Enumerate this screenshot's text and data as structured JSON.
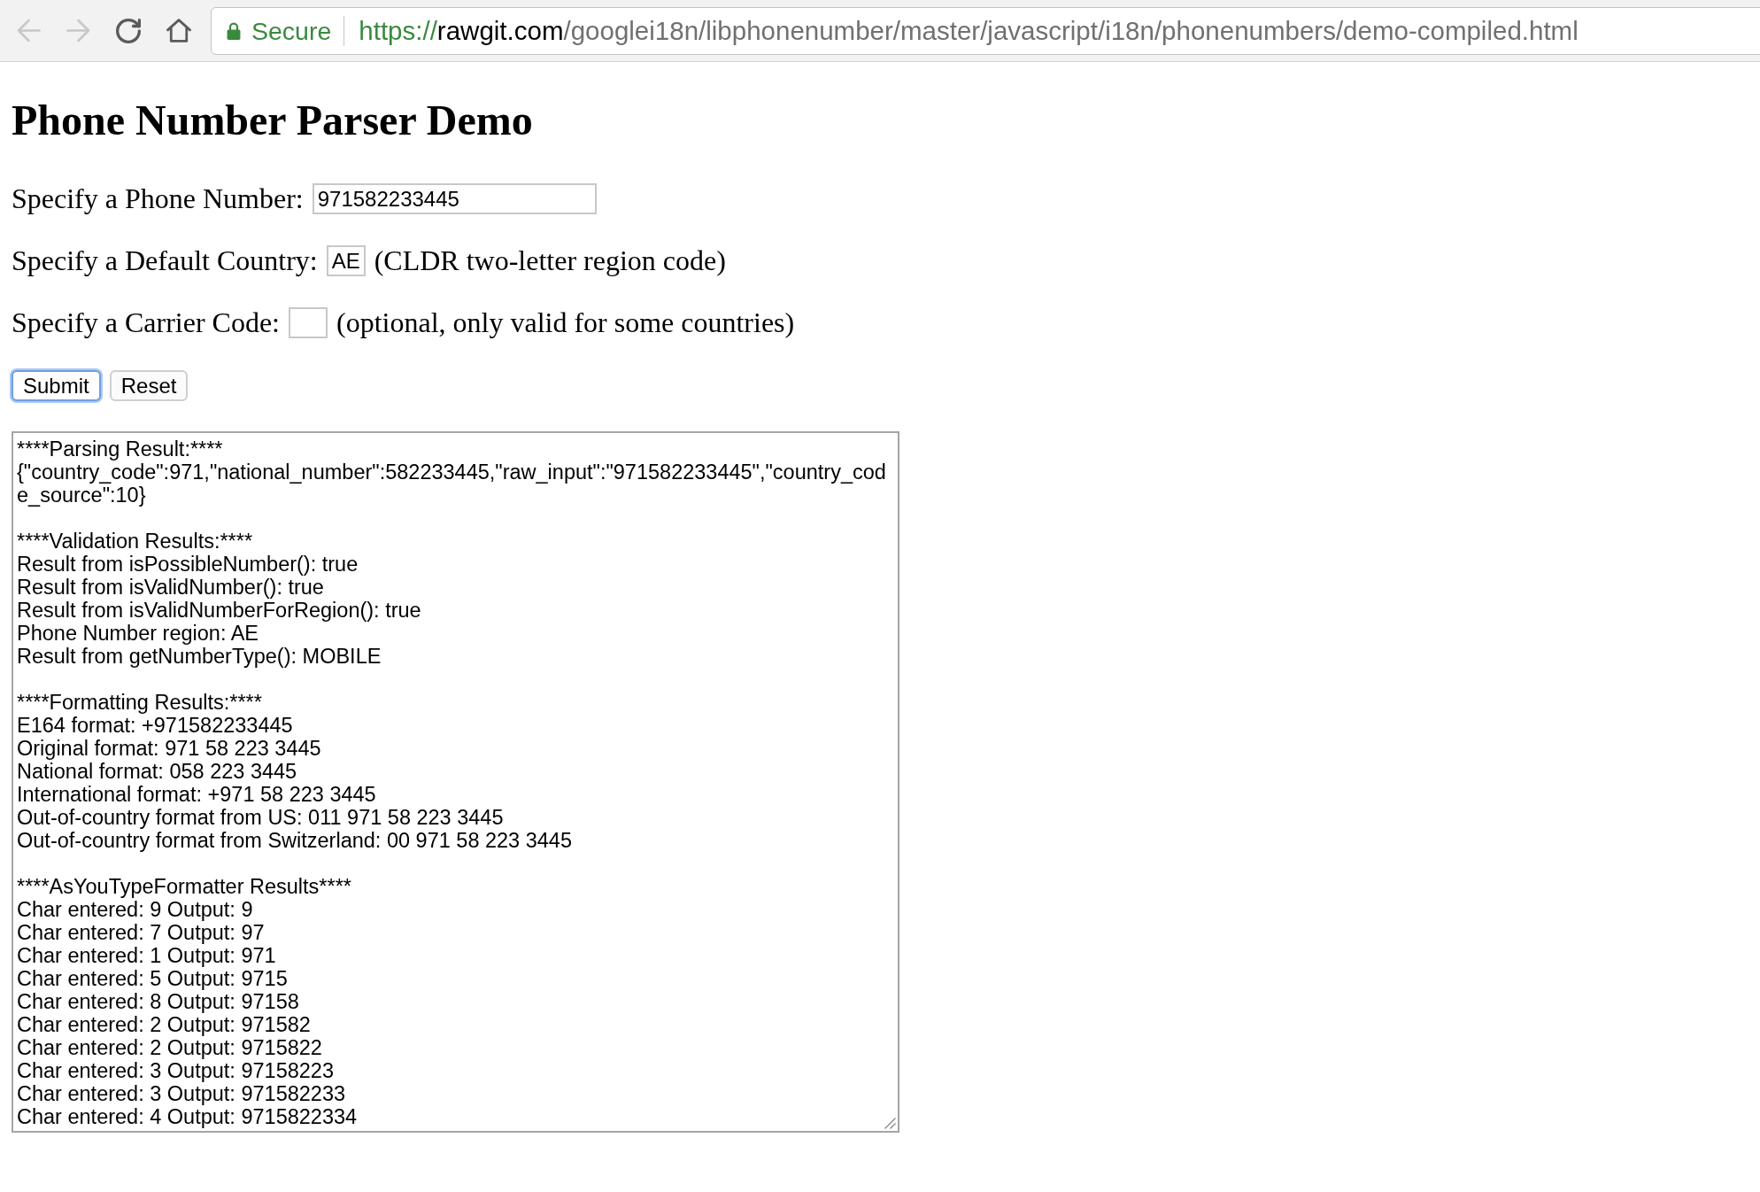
{
  "browser": {
    "nav_buttons": [
      {
        "kind": "back",
        "disabled": true
      },
      {
        "kind": "forward",
        "disabled": true
      },
      {
        "kind": "reload",
        "disabled": false
      },
      {
        "kind": "home",
        "disabled": false
      }
    ],
    "address_bar": {
      "secure": true,
      "security_label": "Secure",
      "url": {
        "scheme": "https://",
        "host": "rawgit.com",
        "path": "/googlei18n/libphonenumber/master/javascript/i18n/phonenumbers/demo-compiled.html"
      }
    }
  },
  "page": {
    "title": "Phone Number Parser Demo",
    "fields": [
      {
        "kind": "long",
        "label": "Specify a Phone Number:",
        "value": "971582233445"
      },
      {
        "kind": "short",
        "label": "Specify a Default Country:",
        "value": "AE",
        "note": "(CLDR two-letter region code)"
      },
      {
        "kind": "short",
        "label": "Specify a Carrier Code:",
        "note": "(optional, only valid for some countries)"
      }
    ],
    "buttons": [
      {
        "label": "Submit",
        "focused": true
      },
      {
        "label": "Reset",
        "focused": false
      }
    ],
    "output": {
      "sections": [
        {
          "heading": "****Parsing Result:****",
          "lines": [
            "{\"country_code\":971,\"national_number\":582233445,\"raw_input\":\"971582233445\",\"country_code_source\":10}"
          ]
        },
        {
          "heading": "****Validation Results:****",
          "lines": [
            "Result from isPossibleNumber(): true",
            "Result from isValidNumber(): true",
            "Result from isValidNumberForRegion(): true",
            "Phone Number region: AE",
            "Result from getNumberType(): MOBILE"
          ]
        },
        {
          "heading": "****Formatting Results:****",
          "lines": [
            "E164 format: +971582233445",
            "Original format: 971 58 223 3445",
            "National format: 058 223 3445",
            "International format: +971 58 223 3445",
            "Out-of-country format from US: 011 971 58 223 3445",
            "Out-of-country format from Switzerland: 00 971 58 223 3445"
          ]
        },
        {
          "heading": "****AsYouTypeFormatter Results****",
          "lines": [
            "Char entered: 9 Output: 9",
            "Char entered: 7 Output: 97",
            "Char entered: 1 Output: 971",
            "Char entered: 5 Output: 9715",
            "Char entered: 8 Output: 97158",
            "Char entered: 2 Output: 971582",
            "Char entered: 2 Output: 9715822",
            "Char entered: 3 Output: 97158223",
            "Char entered: 3 Output: 971582233",
            "Char entered: 4 Output: 9715822334"
          ]
        }
      ]
    }
  }
}
